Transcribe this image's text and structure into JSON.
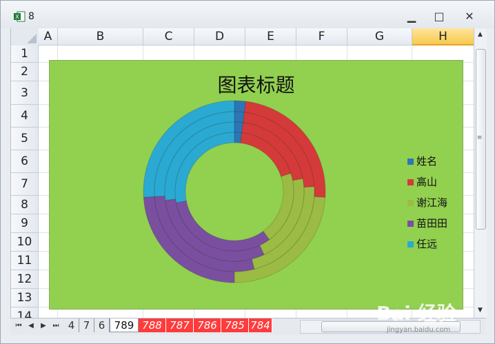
{
  "window": {
    "title": "8",
    "minimize": "▁",
    "maximize": "□",
    "close": "✕"
  },
  "columns": [
    "A",
    "B",
    "C",
    "D",
    "E",
    "F",
    "G",
    "H"
  ],
  "selected_column": "H",
  "rows": [
    "1",
    "2",
    "3",
    "4",
    "5",
    "6",
    "7",
    "8",
    "9",
    "10",
    "11",
    "12",
    "13",
    "14"
  ],
  "sheet_tabs": [
    {
      "label": "4",
      "style": "plain"
    },
    {
      "label": "7",
      "style": "plain"
    },
    {
      "label": "6",
      "style": "plain"
    },
    {
      "label": "789",
      "style": "active"
    },
    {
      "label": "788",
      "style": "red"
    },
    {
      "label": "787",
      "style": "red"
    },
    {
      "label": "786",
      "style": "red"
    },
    {
      "label": "785",
      "style": "red"
    },
    {
      "label": "784",
      "style": "red"
    }
  ],
  "colors": {
    "chart_bg": "#92d050",
    "姓名": "#2e75b6",
    "高山": "#d43a3a",
    "谢江海": "#9bbb45",
    "苗田田": "#7a4fa0",
    "任远": "#2aa9d2"
  },
  "chart_data": {
    "type": "doughnut",
    "title": "图表标题",
    "legend_position": "right",
    "categories": [
      "姓名",
      "高山",
      "谢江海",
      "苗田田",
      "任远"
    ],
    "rings": [
      {
        "values": [
          2,
          24,
          24,
          24,
          26
        ]
      },
      {
        "values": [
          2,
          22,
          22,
          28,
          26
        ]
      },
      {
        "values": [
          2,
          20,
          21,
          30,
          27
        ]
      },
      {
        "values": [
          2,
          18,
          20,
          32,
          28
        ]
      }
    ]
  },
  "watermark": {
    "text": "Bai 经验",
    "url": "jingyan.baidu.com"
  }
}
